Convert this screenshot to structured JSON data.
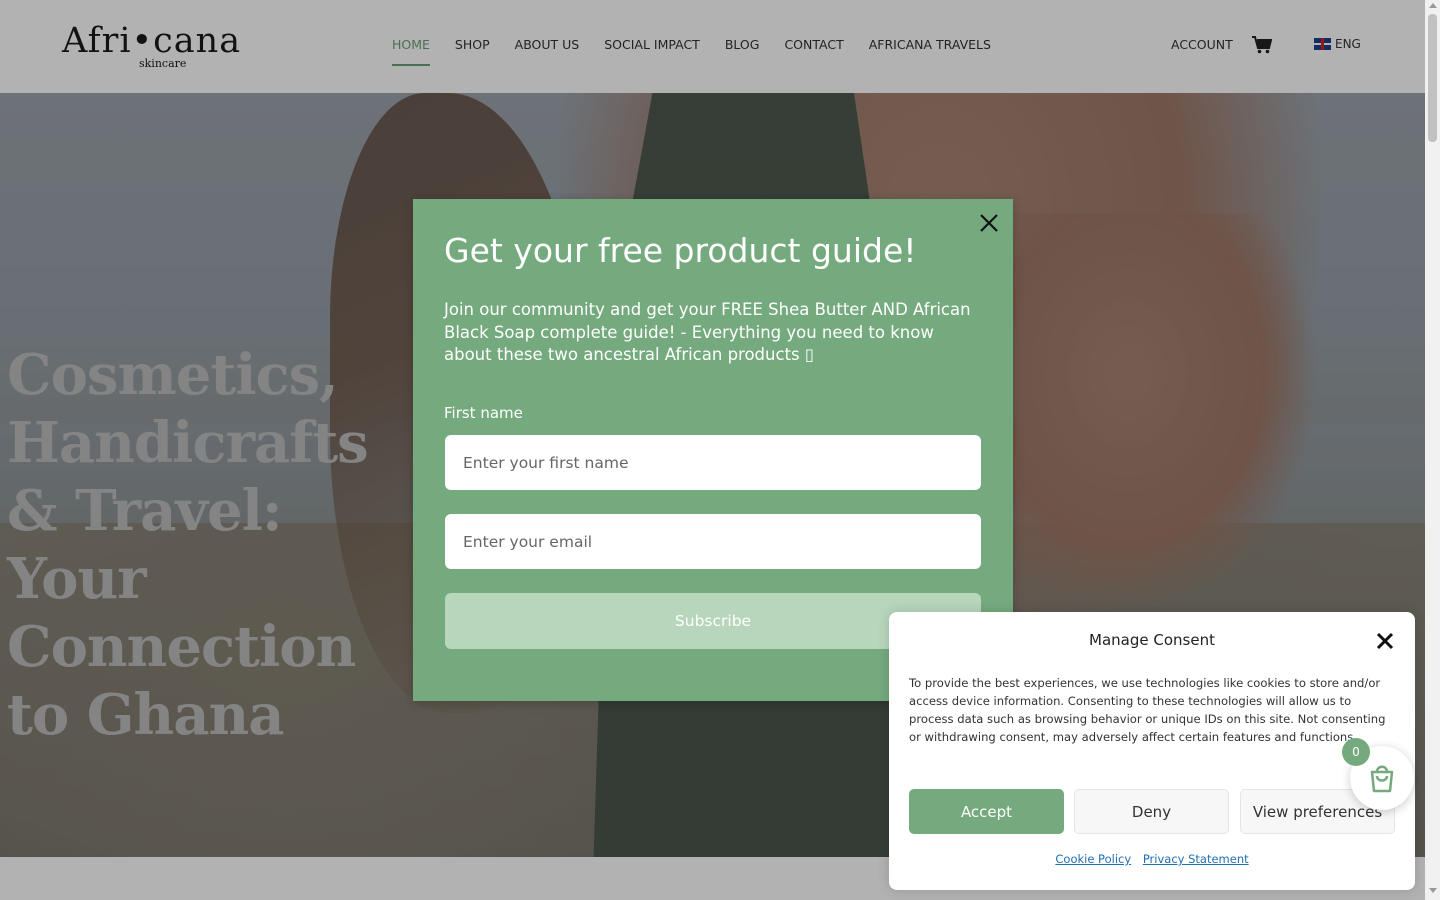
{
  "brand": {
    "name": "Afri•cana",
    "sub": "skincare"
  },
  "nav": {
    "items": [
      {
        "label": "HOME",
        "active": true
      },
      {
        "label": "SHOP"
      },
      {
        "label": "ABOUT US"
      },
      {
        "label": "SOCIAL IMPACT"
      },
      {
        "label": "BLOG"
      },
      {
        "label": "CONTACT"
      },
      {
        "label": "AFRICANA TRAVELS"
      }
    ],
    "account": "ACCOUNT",
    "language": "ENG"
  },
  "hero": {
    "title": "Cosmetics, Handicrafts & Travel: Your Connection to Ghana"
  },
  "popup": {
    "title": "Get your free product guide!",
    "description": "Join our community and get your FREE Shea Butter AND African Black Soap complete guide! - Everything you need to know about these two ancestral African products ▯",
    "first_name_label": "First name",
    "first_name_placeholder": "Enter your first name",
    "email_placeholder": "Enter your email",
    "subscribe_label": "Subscribe"
  },
  "consent": {
    "title": "Manage Consent",
    "text": "To provide the best experiences, we use technologies like cookies to store and/or access device information. Consenting to these technologies will allow us to process data such as browsing behavior or unique IDs on this site. Not consenting or withdrawing consent, may adversely affect certain features and functions.",
    "accept": "Accept",
    "deny": "Deny",
    "preferences": "View preferences",
    "cookie_policy": "Cookie Policy",
    "privacy": "Privacy Statement"
  },
  "cart": {
    "count": "0"
  },
  "colors": {
    "accent": "#75aa7e",
    "accent_light": "#b7d6bc",
    "link": "#1f6fb5"
  }
}
